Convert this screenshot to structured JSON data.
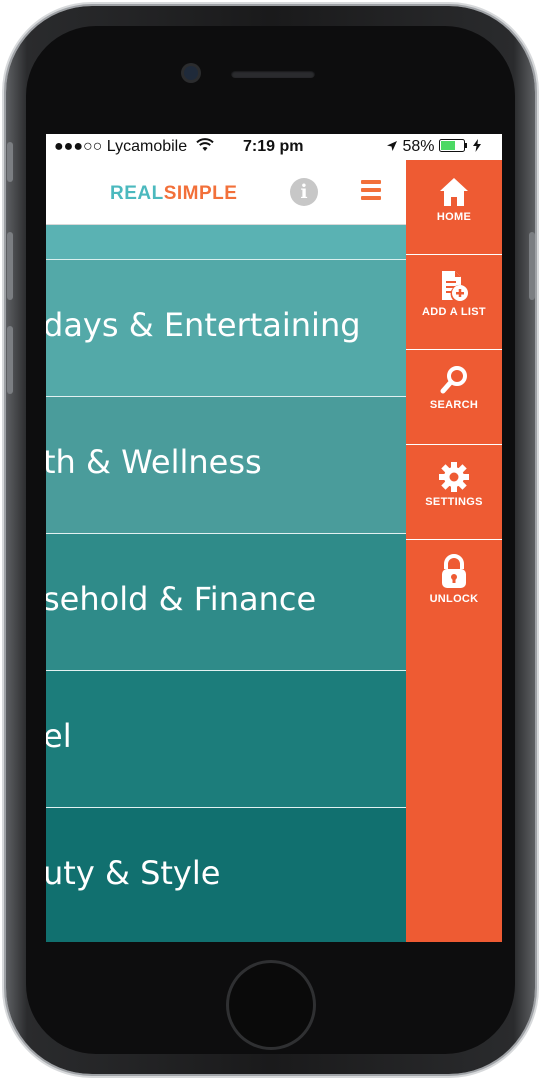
{
  "status_bar": {
    "signal": "●●●○○",
    "carrier": "Lycamobile",
    "time": "7:19 pm",
    "battery": "58%"
  },
  "header": {
    "logo_part1": "REAL",
    "logo_part2": "SIMPLE",
    "info_glyph": "i"
  },
  "categories": [
    {
      "label": "days & Entertaining",
      "color": "#53a9a8"
    },
    {
      "label": "th & Wellness",
      "color": "#4a9c9b"
    },
    {
      "label": "sehold & Finance",
      "color": "#2f8b89"
    },
    {
      "label": "el",
      "color": "#1c7d7b"
    },
    {
      "label": "uty & Style",
      "color": "#11706f"
    }
  ],
  "side_menu": {
    "items": [
      {
        "label": "HOME",
        "icon": "home-icon"
      },
      {
        "label": "ADD A LIST",
        "icon": "add-list-icon"
      },
      {
        "label": "SEARCH",
        "icon": "search-icon"
      },
      {
        "label": "SETTINGS",
        "icon": "gear-icon"
      },
      {
        "label": "UNLOCK",
        "icon": "lock-icon"
      }
    ]
  },
  "colors": {
    "accent": "#ee5b33",
    "teal": "#4bb9be"
  }
}
